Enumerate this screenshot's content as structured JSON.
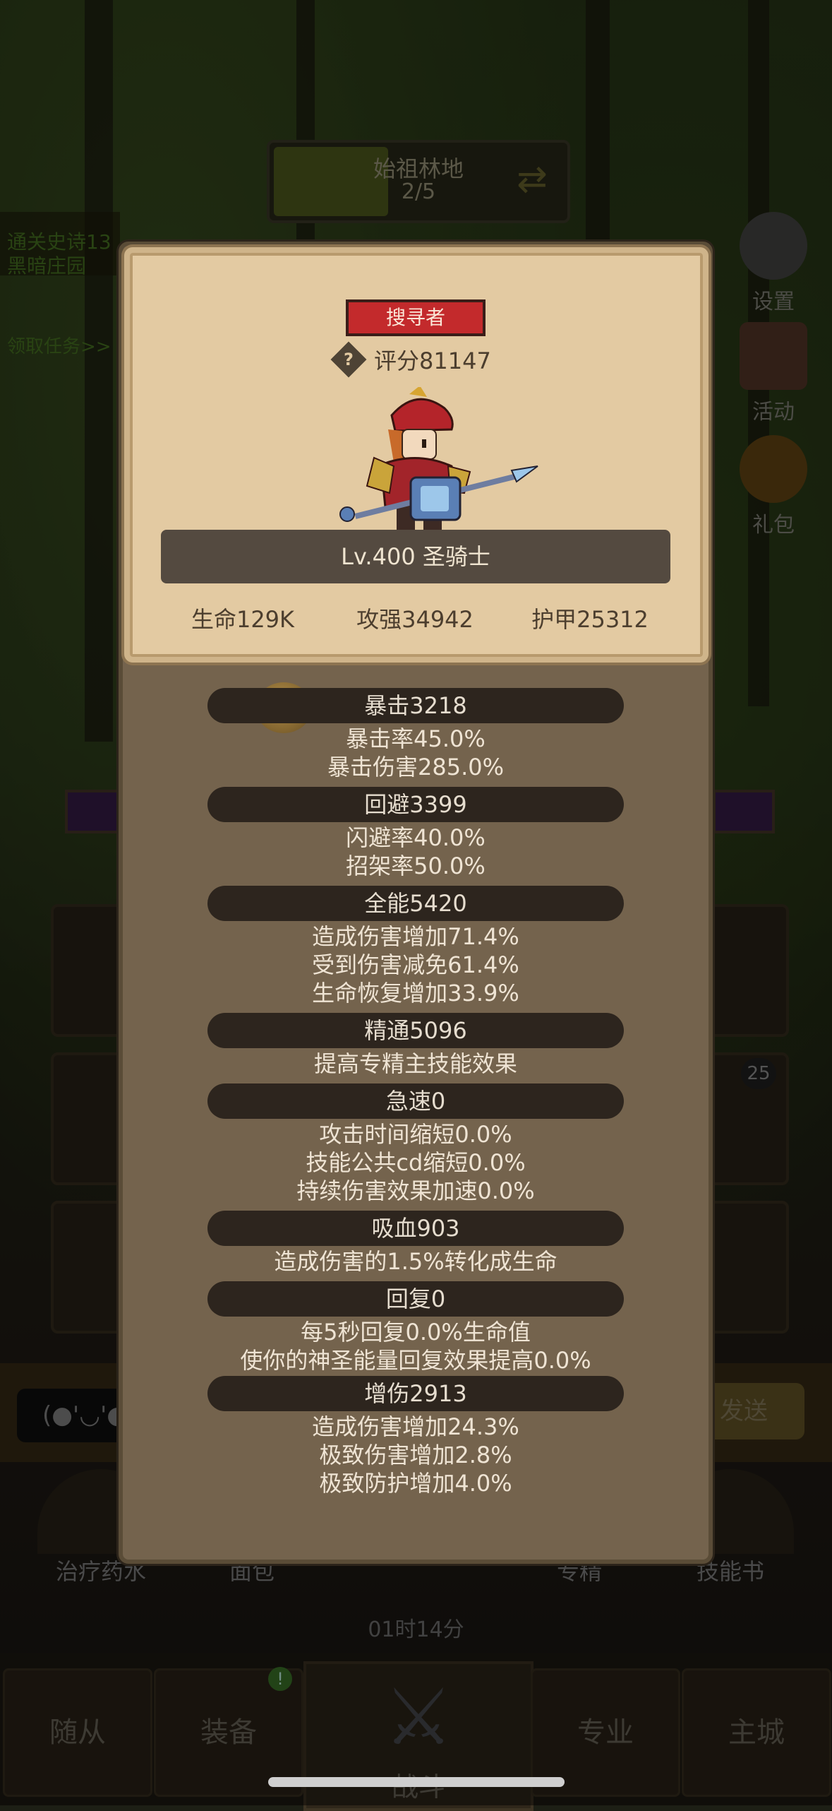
{
  "background": {
    "stage": {
      "name": "始祖林地",
      "progress": "2/5"
    },
    "quest": {
      "lines": [
        "通关史诗13",
        "黑暗庄园"
      ],
      "claim": "领取任务>>"
    },
    "side_buttons": [
      {
        "label": "设置",
        "icon": "gear-icon"
      },
      {
        "label": "活动",
        "icon": "calendar-icon"
      },
      {
        "label": "礼包",
        "icon": "gift-icon"
      }
    ],
    "slot_badge": "25",
    "chat": {
      "emote": "(●'◡'●",
      "send": "发送"
    },
    "consumables": [
      "治疗药水",
      "面包",
      "专精",
      "技能书"
    ],
    "timer": "01时14分",
    "nav": {
      "tabs": [
        "随从",
        "装备",
        "战斗",
        "专业",
        "主城"
      ],
      "notif": "!"
    }
  },
  "card": {
    "class_tag": "搜寻者",
    "score": "评分81147",
    "level_name": "Lv.400 圣骑士",
    "hp": "生命129K",
    "attack": "攻强34942",
    "armor": "护甲25312"
  },
  "stats": [
    {
      "head": "暴击3218",
      "lines": [
        "暴击率45.0%",
        "暴击伤害285.0%"
      ]
    },
    {
      "head": "回避3399",
      "lines": [
        "闪避率40.0%",
        "招架率50.0%"
      ]
    },
    {
      "head": "全能5420",
      "lines": [
        "造成伤害增加71.4%",
        "受到伤害减免61.4%",
        "生命恢复增加33.9%"
      ]
    },
    {
      "head": "精通5096",
      "lines": [
        "提高专精主技能效果"
      ]
    },
    {
      "head": "急速0",
      "lines": [
        "攻击时间缩短0.0%",
        "技能公共cd缩短0.0%",
        "持续伤害效果加速0.0%"
      ]
    },
    {
      "head": "吸血903",
      "lines": [
        "造成伤害的1.5%转化成生命"
      ]
    },
    {
      "head": "回复0",
      "lines": [
        "每5秒回复0.0%生命值",
        "使你的神圣能量回复效果提高0.0%"
      ]
    },
    {
      "head": "增伤2913",
      "lines": [
        "造成伤害增加24.3%",
        "极致伤害增加2.8%",
        "极致防护增加4.0%"
      ]
    }
  ]
}
